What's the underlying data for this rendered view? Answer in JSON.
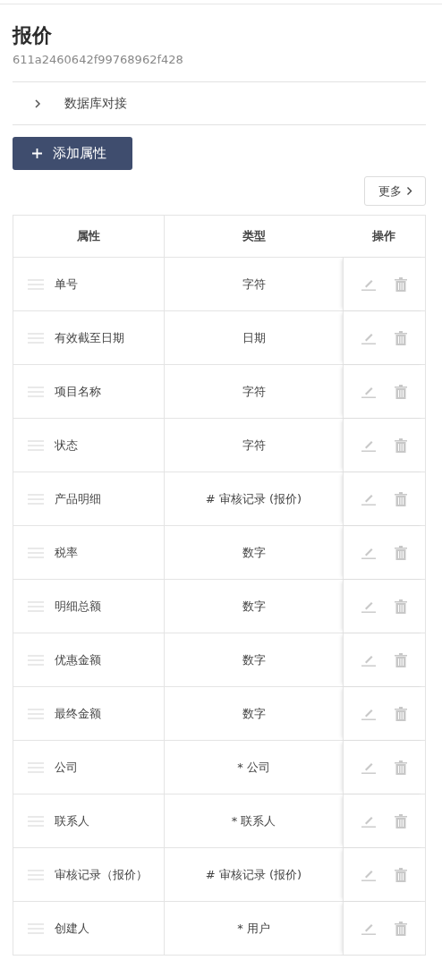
{
  "title": "报价",
  "id": "611a2460642f99768962f428",
  "collapse": {
    "label": "数据库对接",
    "expanded": false
  },
  "add_button": {
    "label": "添加属性"
  },
  "more_button": {
    "label": "更多"
  },
  "table": {
    "columns": [
      "属性",
      "类型",
      "操作"
    ],
    "rows": [
      {
        "name": "单号",
        "type": "字符"
      },
      {
        "name": "有效截至日期",
        "type": "日期"
      },
      {
        "name": "项目名称",
        "type": "字符"
      },
      {
        "name": "状态",
        "type": "字符"
      },
      {
        "name": "产品明细",
        "type": "# 审核记录 (报价)"
      },
      {
        "name": "税率",
        "type": "数字"
      },
      {
        "name": "明细总额",
        "type": "数字"
      },
      {
        "name": "优惠金额",
        "type": "数字"
      },
      {
        "name": "最终金额",
        "type": "数字"
      },
      {
        "name": "公司",
        "type": "* 公司"
      },
      {
        "name": "联系人",
        "type": "* 联系人"
      },
      {
        "name": "审核记录（报价）",
        "type": "# 审核记录 (报价)"
      },
      {
        "name": "创建人",
        "type": "* 用户"
      }
    ]
  }
}
